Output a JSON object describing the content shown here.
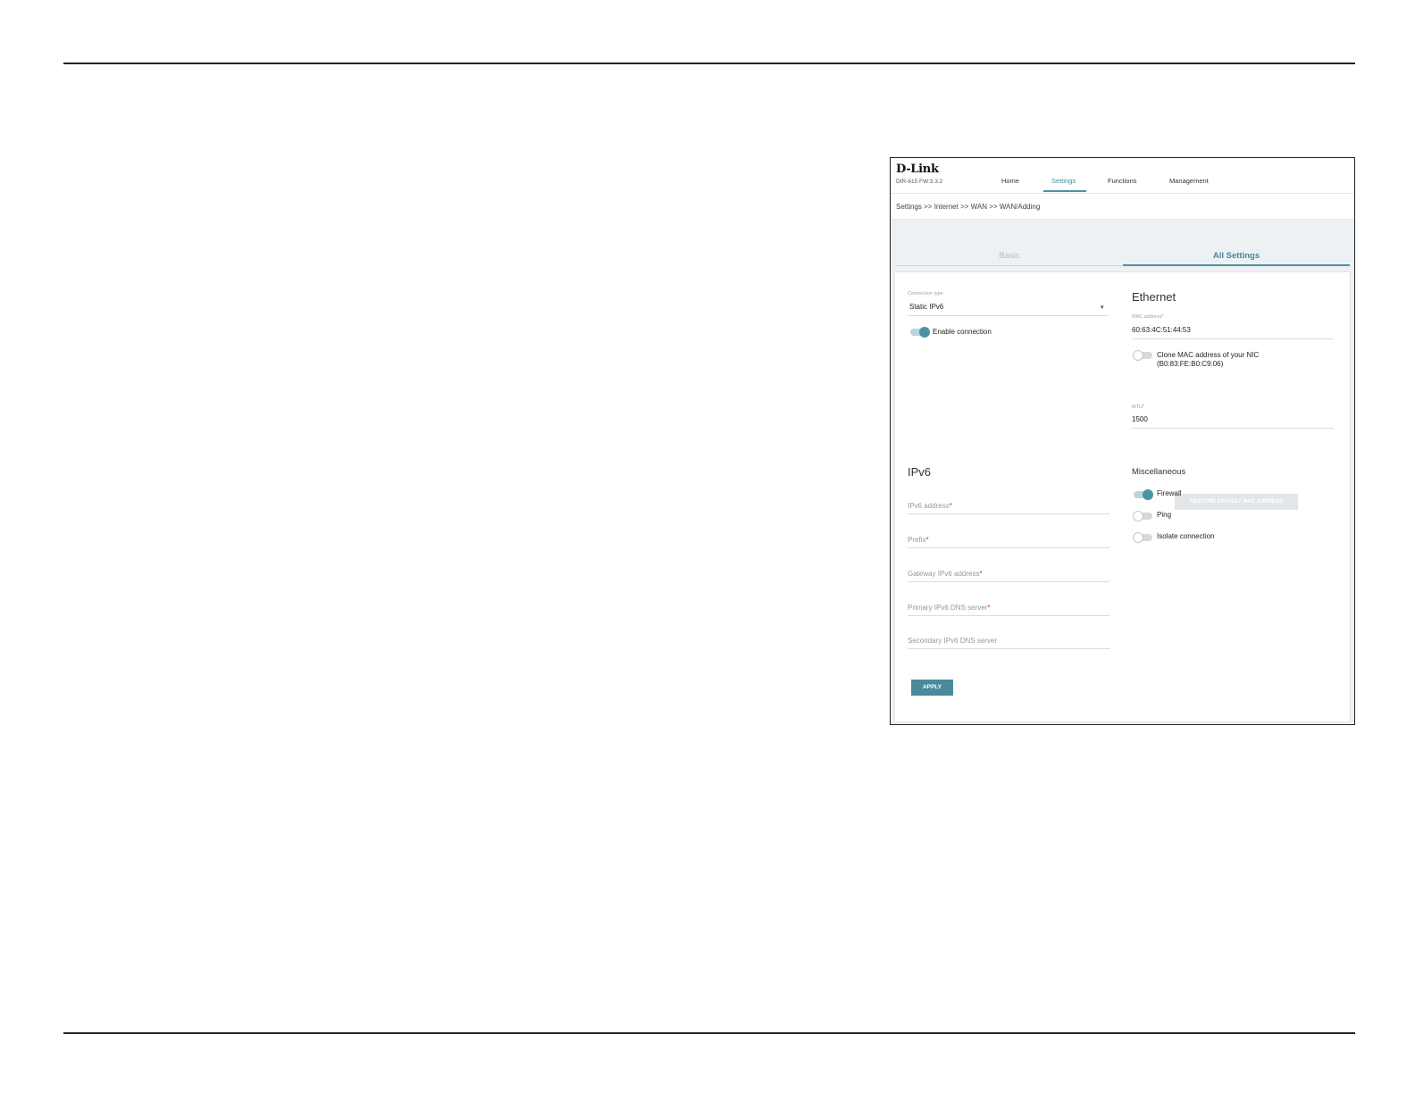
{
  "header": {
    "logo": "D-Link",
    "firmware": "DIR-615 FW:3.3.2",
    "nav": [
      "Home",
      "Settings",
      "Functions",
      "Management"
    ]
  },
  "breadcrumb": "Settings >> Internet >> WAN >> WAN/Adding",
  "tabs": {
    "basic": "Basic",
    "all": "All Settings"
  },
  "connection": {
    "type_label": "Connection type",
    "type_value": "Static IPv6",
    "enable_label": "Enable connection",
    "enable_on": true
  },
  "ethernet": {
    "title": "Ethernet",
    "mac_label": "MAC address*",
    "mac_value": "60:63:4C:51:44:53",
    "clone_label_line1": "Clone MAC address of your NIC",
    "clone_label_line2": "(B0:83:FE:B0:C9:06)",
    "clone_on": false,
    "restore_button": "RESTORE DEFAULT MAC ADDRESS",
    "mtu_label": "MTU*",
    "mtu_value": "1500"
  },
  "ipv6": {
    "title": "IPv6",
    "fields": [
      {
        "label": "IPv6 address",
        "required": "*"
      },
      {
        "label": "Prefix",
        "required": "*"
      },
      {
        "label": "Gateway IPv6 address",
        "required": "*"
      },
      {
        "label": "Primary IPv6 DNS server",
        "required": "*"
      },
      {
        "label": "Secondary IPv6 DNS server",
        "required": ""
      }
    ]
  },
  "misc": {
    "title": "Miscellaneous",
    "items": [
      {
        "label": "Firewall",
        "on": true
      },
      {
        "label": "Ping",
        "on": false
      },
      {
        "label": "Isolate connection",
        "on": false
      }
    ]
  },
  "apply_button": "APPLY",
  "colors": {
    "accent": "#4a93a3",
    "required": "#d0342c"
  }
}
